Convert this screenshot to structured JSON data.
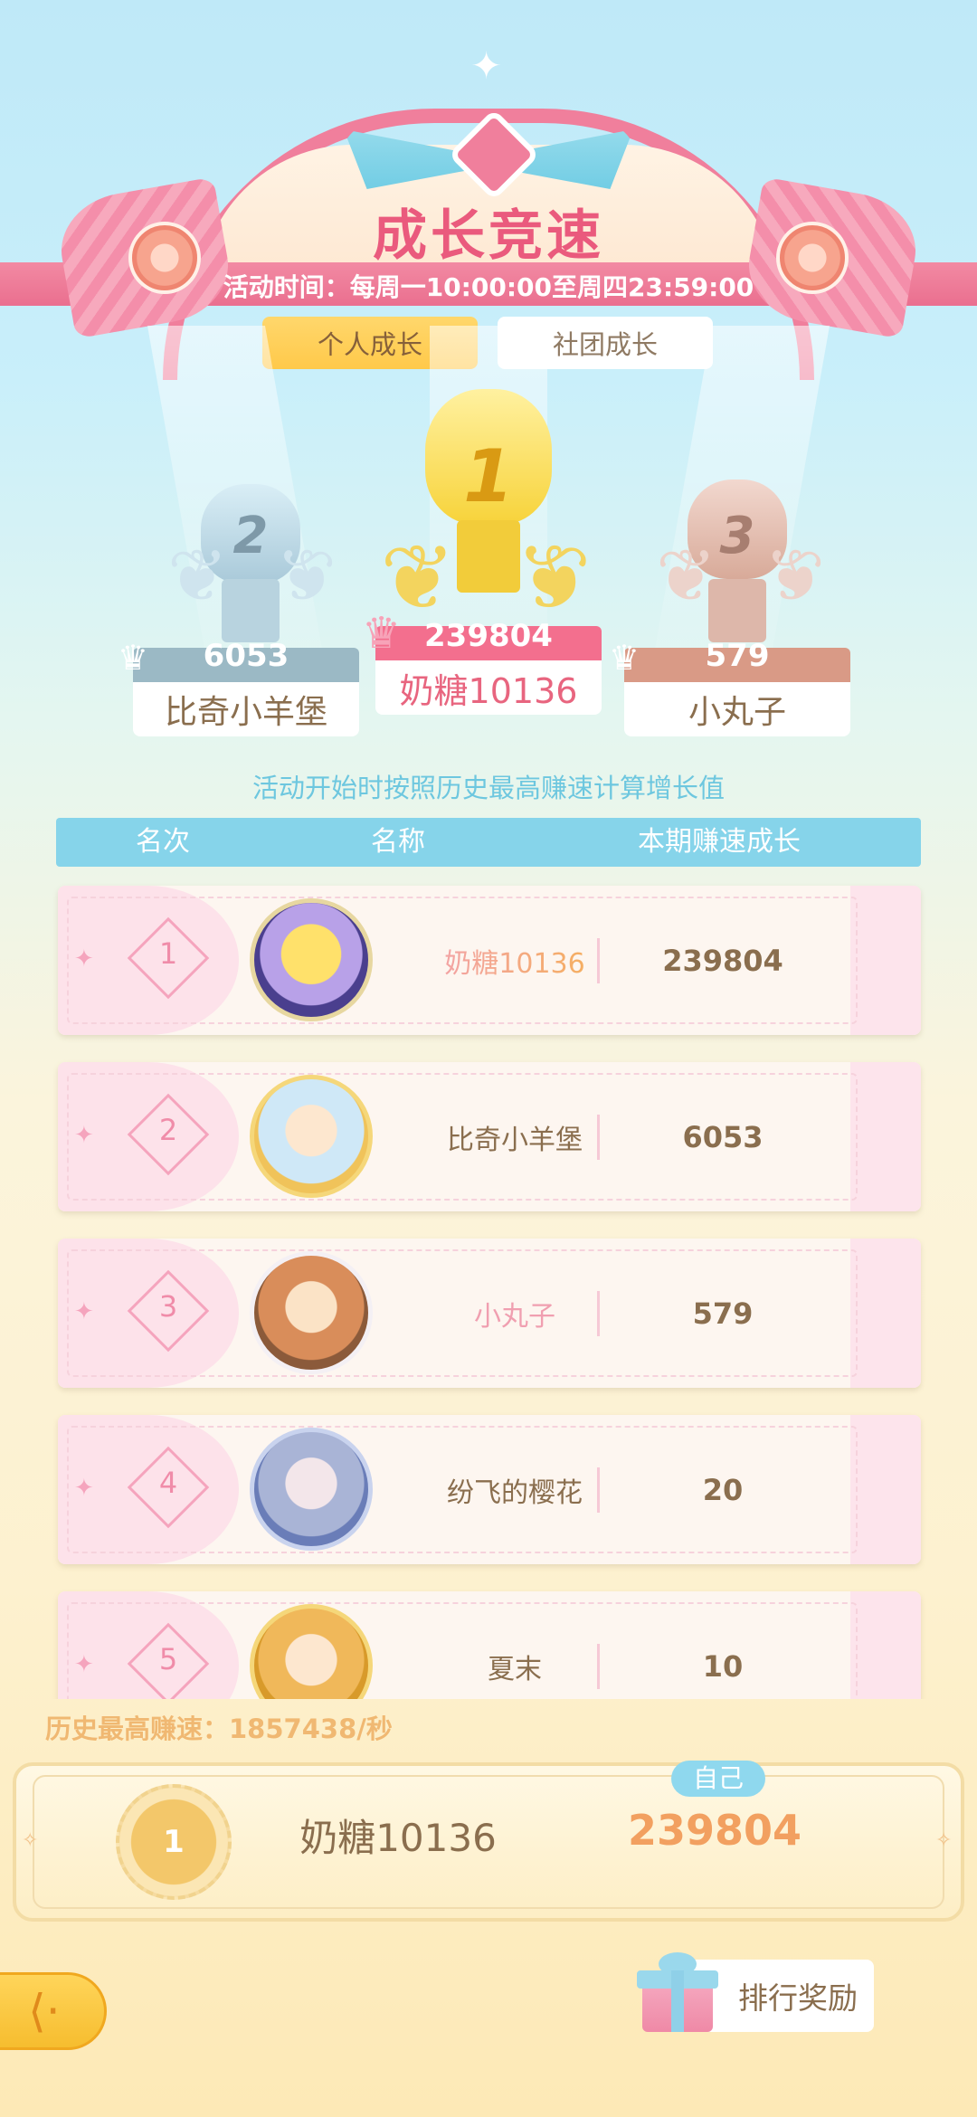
{
  "header": {
    "title": "成长竞速",
    "time": "活动时间：每周一10:00:00至周四23:59:00"
  },
  "tabs": [
    {
      "label": "个人成长",
      "active": true
    },
    {
      "label": "社团成长",
      "active": false
    }
  ],
  "podium": {
    "first": {
      "rank": "1",
      "name": "奶糖10136",
      "score": "239804"
    },
    "second": {
      "rank": "2",
      "name": "比奇小羊堡",
      "score": "6053"
    },
    "third": {
      "rank": "3",
      "name": "小丸子",
      "score": "579"
    }
  },
  "note": "活动开始时按照历史最高赚速计算增长值",
  "table": {
    "headers": {
      "rank": "名次",
      "name": "名称",
      "growth": "本期赚速成长"
    },
    "rows": [
      {
        "rank": "1",
        "name": "奶糖10136",
        "value": "239804",
        "avatar": "kero-avatar-icon"
      },
      {
        "rank": "2",
        "name": "比奇小羊堡",
        "value": "6053",
        "avatar": "sakura-avatar-icon"
      },
      {
        "rank": "3",
        "name": "小丸子",
        "value": "579",
        "avatar": "sakura-avatar-icon"
      },
      {
        "rank": "4",
        "name": "纷飞的樱花",
        "value": "20",
        "avatar": "couple-avatar-icon"
      },
      {
        "rank": "5",
        "name": "夏末",
        "value": "10",
        "avatar": "sakura-avatar-icon"
      }
    ]
  },
  "best_speed": "历史最高赚速：1857438/秒",
  "self": {
    "badge": "自己",
    "rank": "1",
    "name": "奶糖10136",
    "value": "239804"
  },
  "footer": {
    "back_icon": "back-arrow-icon",
    "reward_label": "排行奖励"
  },
  "colors": {
    "accent_pink": "#ea5a7d",
    "tab_active": "#ffc94a",
    "table_header": "#86d4ea",
    "self_value": "#f2a060"
  }
}
